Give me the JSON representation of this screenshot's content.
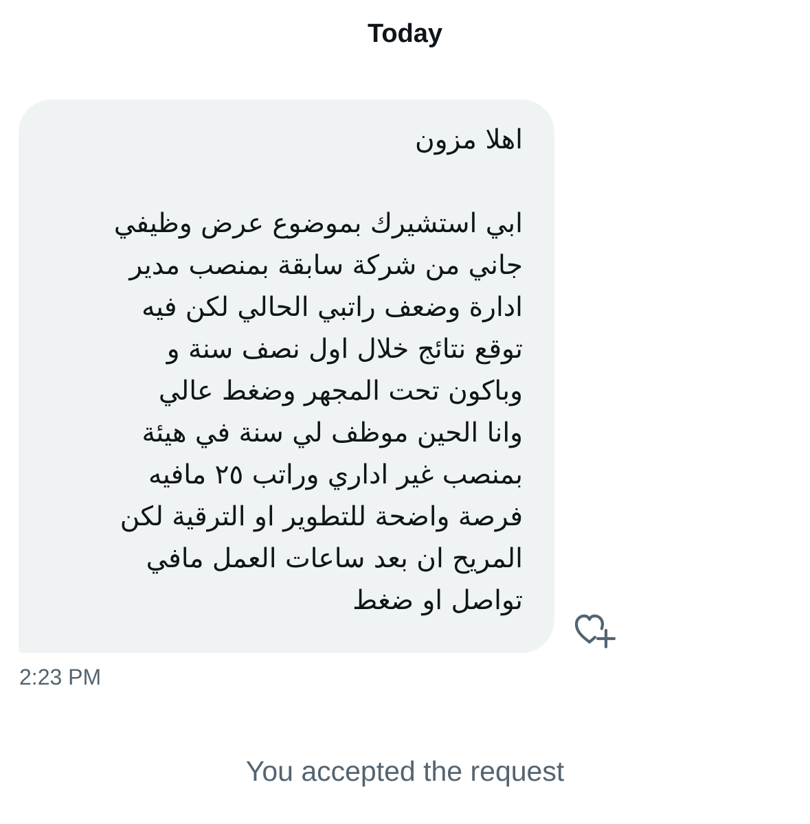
{
  "conversation": {
    "date_label": "Today",
    "message": {
      "greeting": "اهلا مزون",
      "lines": [
        "ابي استشيرك بموضوع عرض وظيفي",
        "جاني من شركة سابقة بمنصب مدير",
        "ادارة وضعف راتبي الحالي لكن فيه",
        "توقع نتائج خلال اول نصف سنة و",
        "وباكون تحت المجهر وضغط عالي",
        "وانا الحين موظف لي سنة في هيئة",
        "بمنصب غير اداري وراتب ٢٥ مافيه",
        "فرصة واضحة للتطوير او الترقية لكن",
        "المريح ان بعد ساعات العمل مافي",
        "تواصل او ضغط"
      ],
      "timestamp": "2:23 PM",
      "react_icon": "heart-plus-icon"
    },
    "system_notice": "You accepted the request"
  },
  "colors": {
    "bubble_bg": "#eff3f4",
    "text_primary": "#0f1419",
    "text_secondary": "#536471"
  }
}
